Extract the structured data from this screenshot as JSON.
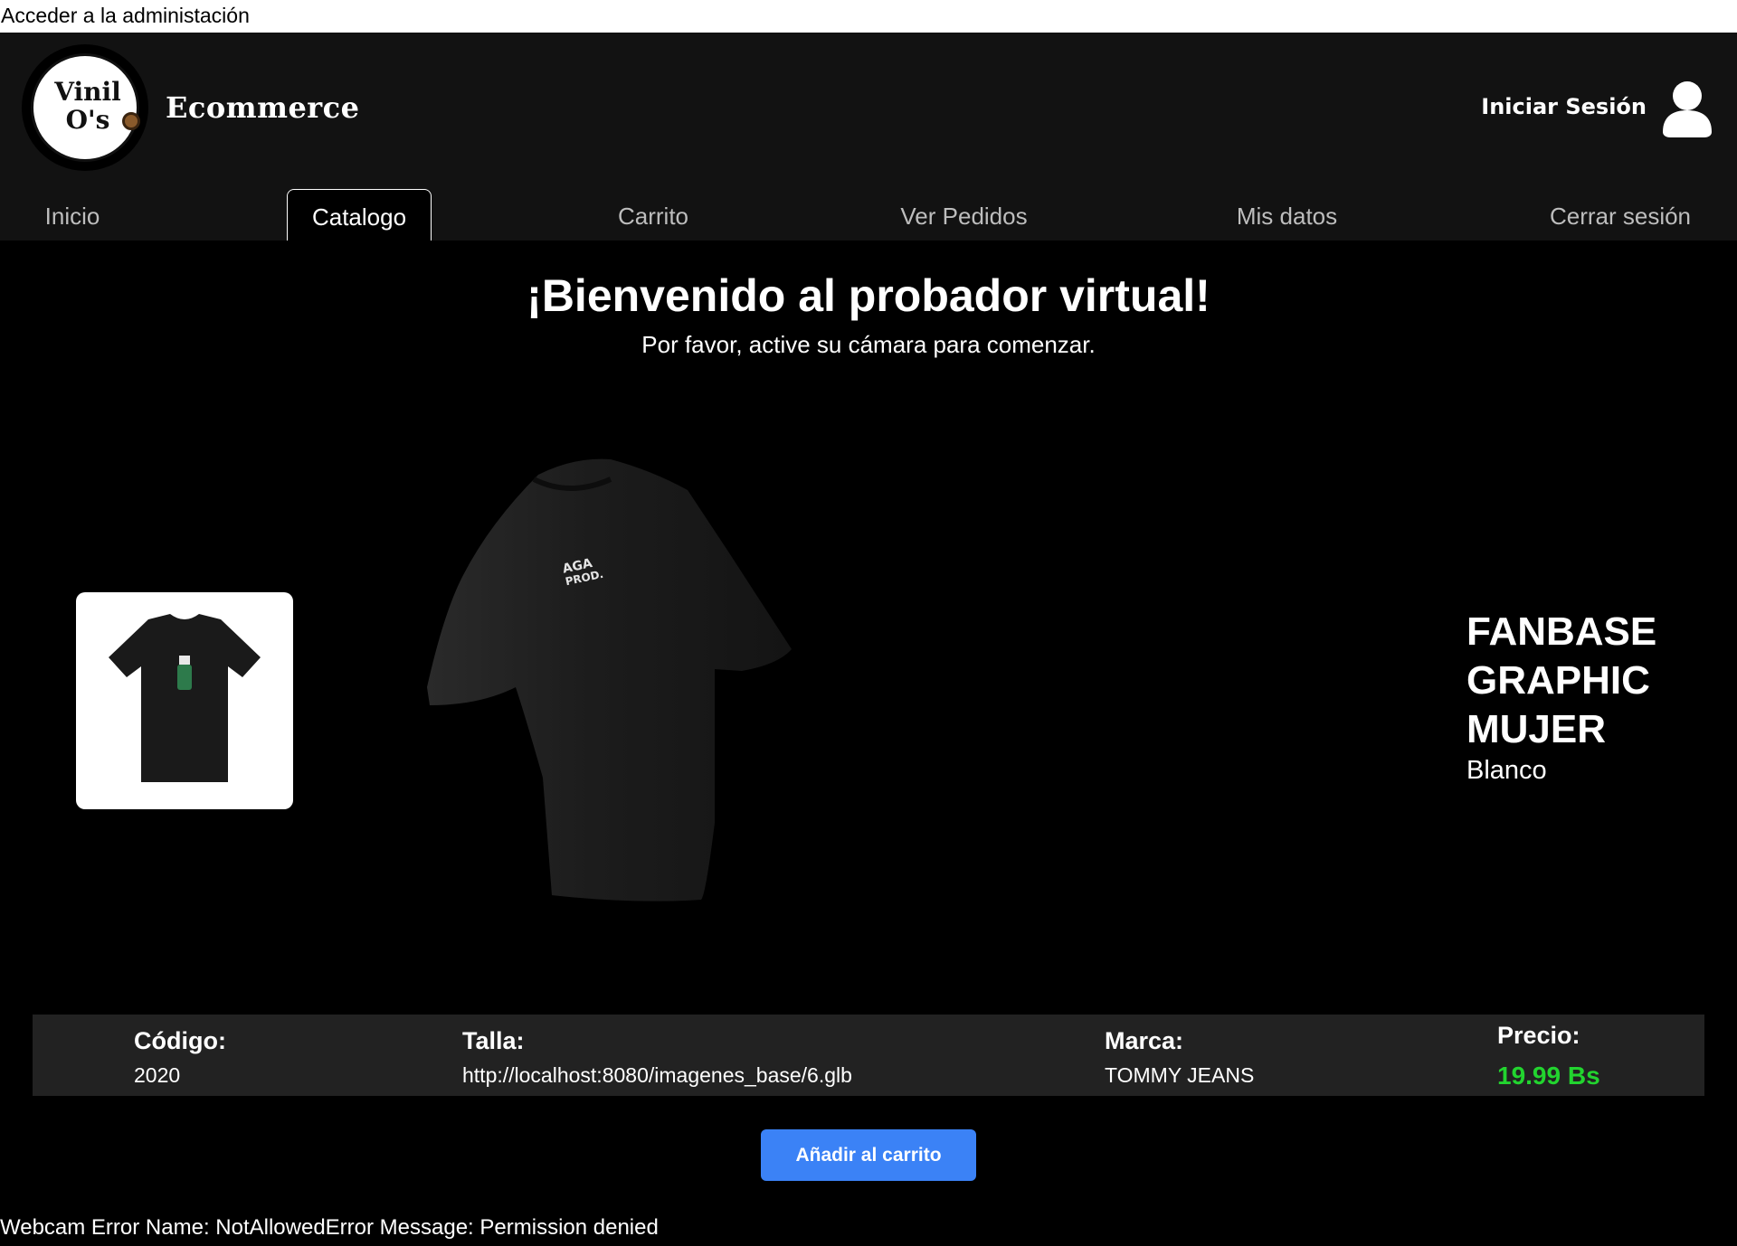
{
  "admin_link": "Acceder a la administación",
  "header": {
    "logo_text_line1": "Vinil",
    "logo_text_line2": "O's",
    "brand": "Ecommerce",
    "login_label": "Iniciar Sesión",
    "user_icon": "user-icon"
  },
  "nav": {
    "items": [
      {
        "label": "Inicio",
        "active": false
      },
      {
        "label": "Catalogo",
        "active": true
      },
      {
        "label": "Carrito",
        "active": false
      },
      {
        "label": "Ver Pedidos",
        "active": false
      },
      {
        "label": "Mis datos",
        "active": false
      },
      {
        "label": "Cerrar sesión",
        "active": false
      }
    ]
  },
  "main": {
    "title": "¡Bienvenido al probador virtual!",
    "subtitle": "Por favor, active su cámara para comenzar."
  },
  "product": {
    "name": "FANBASE GRAPHIC MUJER",
    "color": "Blanco",
    "thumbnail_icon": "tshirt-thumbnail",
    "model_icon": "tshirt-3d-model"
  },
  "info": {
    "code_label": "Código:",
    "code_value": "2020",
    "size_label": "Talla:",
    "size_value": "http://localhost:8080/imagenes_base/6.glb",
    "brand_label": "Marca:",
    "brand_value": "TOMMY JEANS",
    "price_label": "Precio:",
    "price_value": "19.99 Bs"
  },
  "add_to_cart_label": "Añadir al carrito",
  "error_message": "Webcam Error Name: NotAllowedError Message: Permission denied",
  "colors": {
    "header_bg": "#121212",
    "accent_button": "#3b82f6",
    "price": "#22d42f",
    "info_bar": "#222222"
  }
}
